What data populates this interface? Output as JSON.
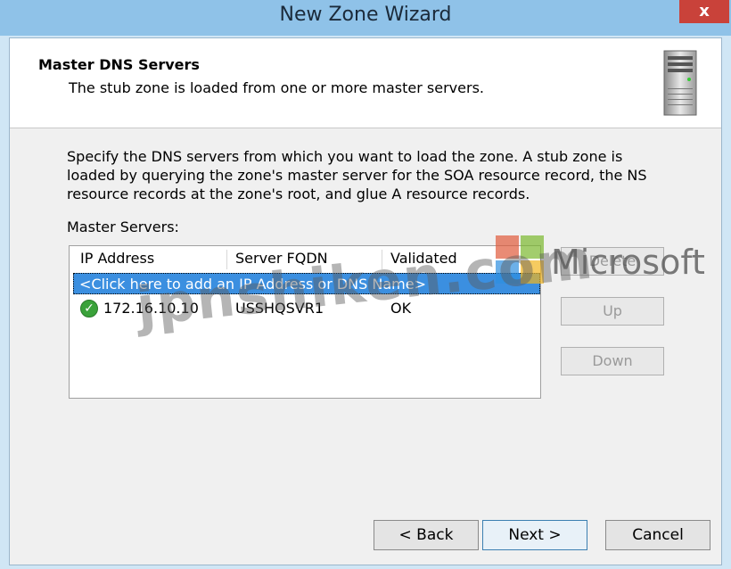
{
  "window": {
    "title": "New Zone Wizard",
    "close_label": "x"
  },
  "header": {
    "title": "Master DNS Servers",
    "subtitle": "The stub zone is loaded from one or more master servers."
  },
  "body": {
    "description": "Specify the DNS servers from which you want to load the zone. A stub zone is loaded by querying the zone's master server for the SOA resource record, the NS resource records at the zone's root, and glue A resource records.",
    "list_label": "Master Servers:"
  },
  "table": {
    "columns": [
      "IP Address",
      "Server FQDN",
      "Validated"
    ],
    "add_row_text": "<Click here to add an IP Address or DNS Name>",
    "rows": [
      {
        "ip": "172.16.10.10",
        "fqdn": "USSHQSVR1",
        "validated": "OK"
      }
    ]
  },
  "side_buttons": {
    "delete": "Delete",
    "up": "Up",
    "down": "Down"
  },
  "footer": {
    "back": "< Back",
    "next": "Next >",
    "cancel": "Cancel"
  },
  "watermark": {
    "text": "jpnshiken.com",
    "logo_text": "Microsoft"
  },
  "colors": {
    "title_bar": "#8fc2e8",
    "close": "#c9423a",
    "selection": "#3b8fe0",
    "check": "#3aa23a"
  },
  "icons": {
    "server": "server-tower-icon",
    "validated": "check-circle-icon"
  }
}
